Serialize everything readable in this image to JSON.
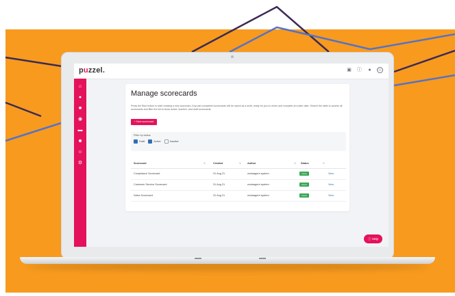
{
  "brand": {
    "logo_prefix": "p",
    "logo_accent": "u",
    "logo_rest": "zzel.",
    "accent_color": "#e4125a",
    "background_color": "#f79a1e"
  },
  "topbar": {
    "icons": [
      "grid-icon",
      "help-circle-icon",
      "bell-icon",
      "user-icon"
    ]
  },
  "sidebar": {
    "icons": [
      "home-icon",
      "chat-icon",
      "clipboard-icon",
      "settings-icon",
      "message-icon",
      "people-icon",
      "person-add-icon",
      "gear-icon"
    ]
  },
  "main": {
    "title": "Manage scorecards",
    "description": "Press the Blue button to start creating a new scorecard. Any part-completed scorecards will be saved as a draft, ready for you to return and complete at a later date. Search the table to access all scorecards and filter the list to show active, inactive, and draft scorecards.",
    "new_button": "+ New scorecard",
    "filter": {
      "title": "Filter by status",
      "options": [
        {
          "label": "Draft",
          "checked": true
        },
        {
          "label": "Active",
          "checked": true
        },
        {
          "label": "Inactive",
          "checked": false
        }
      ]
    },
    "table": {
      "headers": [
        "Scorecard",
        "Created",
        "Author",
        "Status"
      ],
      "rows": [
        {
          "name": "Compliance Scorecard",
          "created": "31 Aug 21",
          "author": "wurlaagent system",
          "status": "Active",
          "action": "View"
        },
        {
          "name": "Customer Service Scorecard",
          "created": "31 Aug 21",
          "author": "wurlaagent system",
          "status": "Active",
          "action": "View"
        },
        {
          "name": "Sales Scorecard",
          "created": "31 Aug 21",
          "author": "wurlaagent system",
          "status": "Active",
          "action": "View"
        }
      ]
    }
  },
  "help_button": "Help"
}
